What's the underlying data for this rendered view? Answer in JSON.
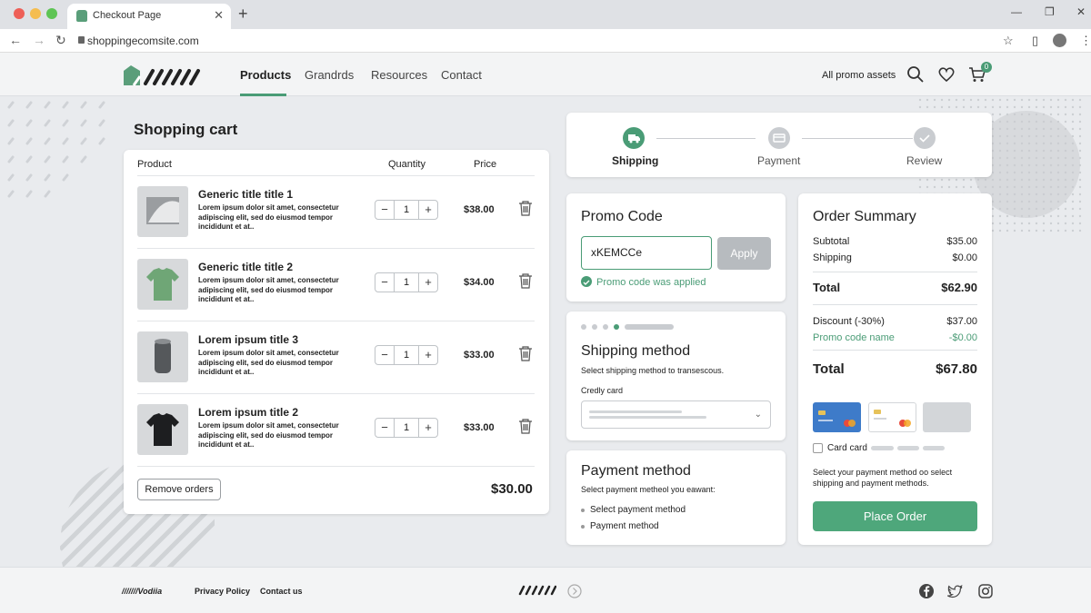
{
  "browser": {
    "tab_title": "Checkout Page",
    "url": "shoppingecomsite.com"
  },
  "nav": {
    "links": [
      "Products",
      "Grandrds",
      "Resources",
      "Contact"
    ],
    "promo_link": "All promo assets",
    "cart_count": "0"
  },
  "cart": {
    "title": "Shopping cart",
    "headers": {
      "product": "Product",
      "quantity": "Quantity",
      "price": "Price"
    },
    "items": [
      {
        "title": "Generic title title 1",
        "desc": "Lorem ipsum dolor sit amet, consectetur adipiscing elit, sed do eiusmod tempor incididunt et at..",
        "qty": "1",
        "price": "$38.00",
        "thumb": "fabric"
      },
      {
        "title": "Generic title title 2",
        "desc": "Lorem ipsum dolor sit amet, consectetur adipiscing elit, sed do eiusmod tempor incididunt et at..",
        "qty": "1",
        "price": "$34.00",
        "thumb": "green-tshirt"
      },
      {
        "title": "Lorem ipsum title 3",
        "desc": "Lorem ipsum dolor sit amet, consectetur adipiscing elit, sed do eiusmod tempor incididunt et at..",
        "qty": "1",
        "price": "$33.00",
        "thumb": "cylinder"
      },
      {
        "title": "Lorem ipsum title 2",
        "desc": "Lorem ipsum dolor sit amet, consectetur adipiscing elit, sed do eiusmod tempor incididunt et at..",
        "qty": "1",
        "price": "$33.00",
        "thumb": "black-tshirt"
      }
    ],
    "remove_label": "Remove orders",
    "total": "$30.00"
  },
  "steps": [
    {
      "label": "Shipping",
      "state": "active"
    },
    {
      "label": "Payment",
      "state": "pending"
    },
    {
      "label": "Review",
      "state": "pending"
    }
  ],
  "promo": {
    "title": "Promo Code",
    "value": "xKEMCCe",
    "apply_label": "Apply",
    "success": "Promo code was applied"
  },
  "shipping": {
    "title": "Shipping method",
    "subtitle": "Select shipping method to transescous.",
    "select_label": "Credly card"
  },
  "payment": {
    "title": "Payment method",
    "subtitle": "Select payment metheol you eawant:",
    "options": [
      "Select payment method",
      "Payment method"
    ]
  },
  "summary": {
    "title": "Order Summary",
    "subtotal_label": "Subtotal",
    "subtotal": "$35.00",
    "shipping_label": "Shipping",
    "shipping": "$0.00",
    "total1_label": "Total",
    "total1": "$62.90",
    "discount_label": "Discount (-30%)",
    "discount": "$37.00",
    "promo_label": "Promo code name",
    "promo_value": "-$0.00",
    "total2_label": "Total",
    "total2": "$67.80",
    "card_label": "Card card",
    "note": "Select your payment method oo select shipping and payment methods.",
    "place_label": "Place Order"
  },
  "footer": {
    "brand": "///////Vodiia",
    "links": [
      "Privacy Policy",
      "Contact us"
    ]
  },
  "colors": {
    "accent": "#4a9c76",
    "button_green": "#4ea77b",
    "apply_disabled": "#b7bbbf"
  }
}
